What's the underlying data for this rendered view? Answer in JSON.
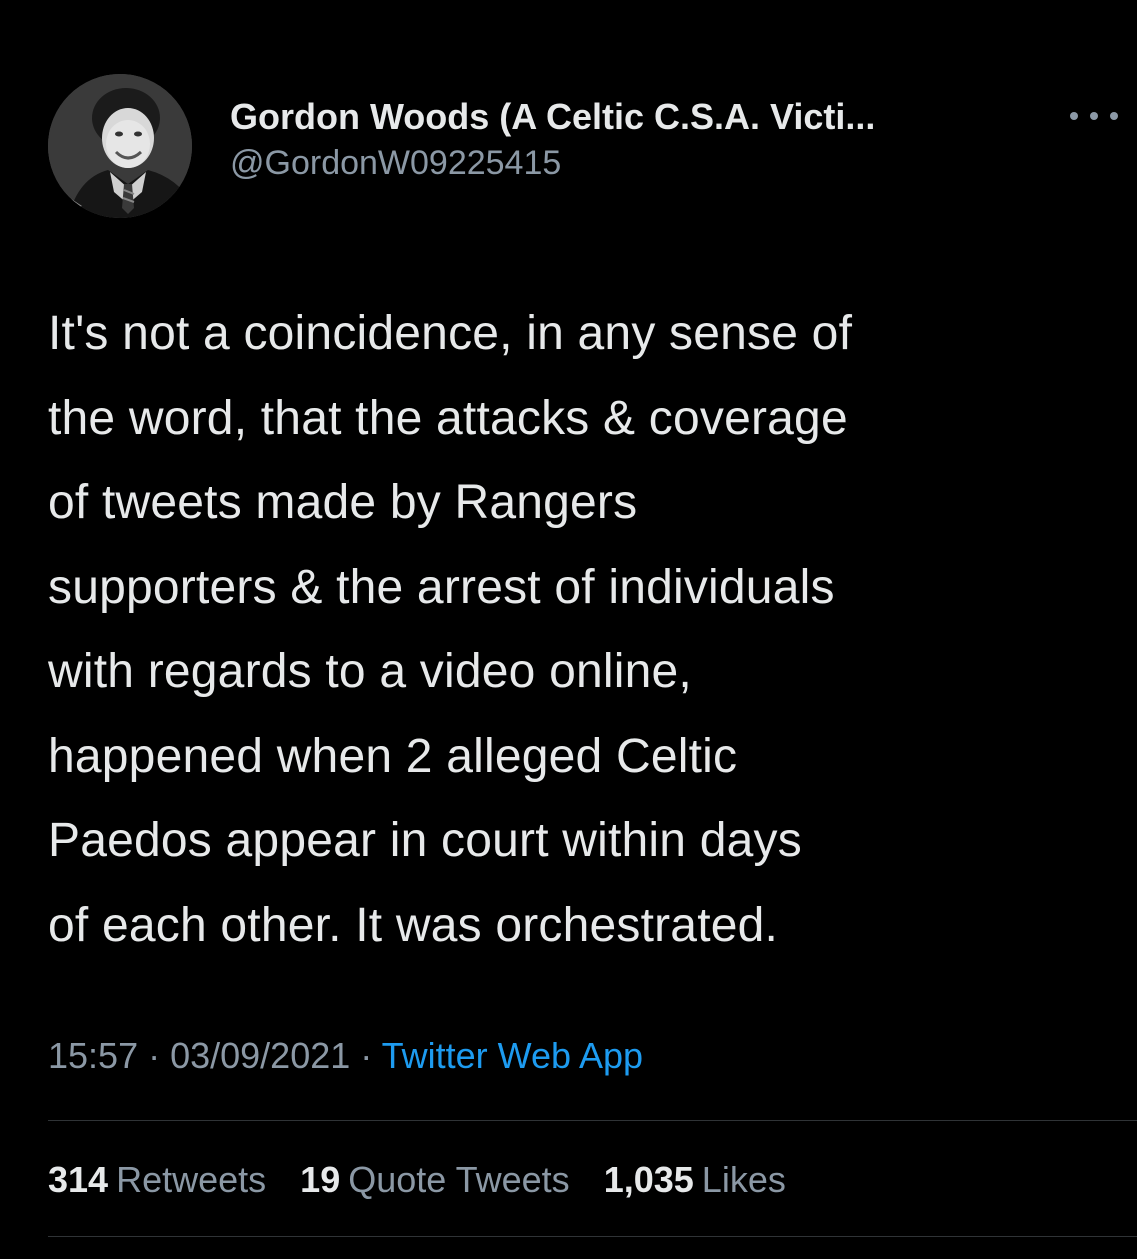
{
  "author": {
    "display_name": "Gordon Woods (A Celtic C.S.A. Victi...",
    "handle": "@GordonW09225415",
    "avatar_icon": "profile-photo"
  },
  "menu_icon": "more-options-icon",
  "tweet": {
    "lines": [
      "It's not a coincidence, in any sense of",
      "the word, that the attacks & coverage",
      "of tweets made by Rangers",
      "supporters & the arrest of individuals",
      "with regards to a video online,",
      "happened when 2 alleged Celtic",
      "Paedos appear in court within days",
      "of each other. It was orchestrated."
    ]
  },
  "meta": {
    "time": "15:57",
    "separator": " · ",
    "date": "03/09/2021",
    "source": "Twitter Web App"
  },
  "stats": {
    "retweets": {
      "count": "314",
      "label": "Retweets"
    },
    "quote_tweets": {
      "count": "19",
      "label": "Quote Tweets"
    },
    "likes": {
      "count": "1,035",
      "label": "Likes"
    }
  },
  "colors": {
    "background": "#000000",
    "primary_text": "#e7e9ea",
    "secondary_text": "#8b98a5",
    "link": "#1d9bf0",
    "divider": "#2f3336"
  }
}
